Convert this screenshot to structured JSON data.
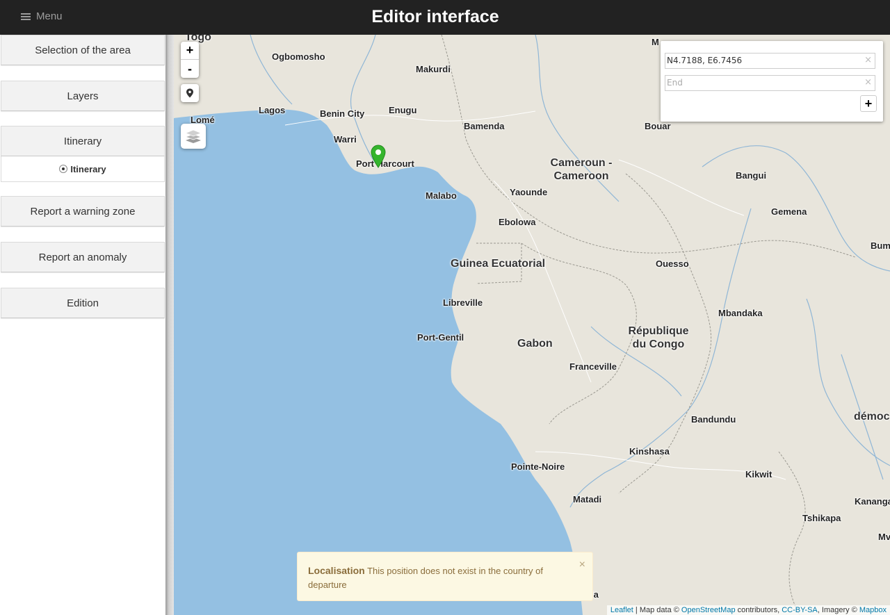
{
  "header": {
    "menu_label": "Menu",
    "title": "Editor interface"
  },
  "sidebar": {
    "selection_label": "Selection of the area",
    "layers_label": "Layers",
    "itinerary_label": "Itinerary",
    "itinerary_option": "Itinerary",
    "warning_label": "Report a warning zone",
    "anomaly_label": "Report an anomaly",
    "edition_label": "Edition"
  },
  "map": {
    "zoom_in": "+",
    "zoom_out": "-",
    "colors": {
      "sea": "#94c0e2",
      "land": "#e8e5dc",
      "river": "#8fb6d6",
      "border": "#9a9890",
      "marker": "#35b52d"
    },
    "places": [
      {
        "id": "togo",
        "name": "Togo",
        "kind": "country"
      },
      {
        "id": "ogbomosho",
        "name": "Ogbomosho",
        "kind": "city"
      },
      {
        "id": "makurdi",
        "name": "Makurdi",
        "kind": "city"
      },
      {
        "id": "lagos",
        "name": "Lagos",
        "kind": "city"
      },
      {
        "id": "benin-city",
        "name": "Benin City",
        "kind": "city"
      },
      {
        "id": "enugu",
        "name": "Enugu",
        "kind": "city"
      },
      {
        "id": "lome",
        "name": "Lomé",
        "kind": "city"
      },
      {
        "id": "warri",
        "name": "Warri",
        "kind": "city"
      },
      {
        "id": "port-harcourt",
        "name": "Port Harcourt",
        "kind": "city"
      },
      {
        "id": "bamenda",
        "name": "Bamenda",
        "kind": "city"
      },
      {
        "id": "bouar",
        "name": "Bouar",
        "kind": "city"
      },
      {
        "id": "cameroun",
        "name": "Cameroun -\nCameroon",
        "kind": "country"
      },
      {
        "id": "bangui",
        "name": "Bangui",
        "kind": "city"
      },
      {
        "id": "malabo",
        "name": "Malabo",
        "kind": "city"
      },
      {
        "id": "yaounde",
        "name": "Yaounde",
        "kind": "city"
      },
      {
        "id": "gemena",
        "name": "Gemena",
        "kind": "city"
      },
      {
        "id": "ebolowa",
        "name": "Ebolowa",
        "kind": "city"
      },
      {
        "id": "bumba",
        "name": "Bumba",
        "kind": "city"
      },
      {
        "id": "guinea-ecuatorial",
        "name": "Guinea Ecuatorial",
        "kind": "country"
      },
      {
        "id": "ouesso",
        "name": "Ouesso",
        "kind": "city"
      },
      {
        "id": "libreville",
        "name": "Libreville",
        "kind": "city"
      },
      {
        "id": "mbandaka",
        "name": "Mbandaka",
        "kind": "city"
      },
      {
        "id": "republique-du-congo",
        "name": "République\ndu Congo",
        "kind": "country"
      },
      {
        "id": "port-gentil",
        "name": "Port-Gentil",
        "kind": "city"
      },
      {
        "id": "gabon",
        "name": "Gabon",
        "kind": "country"
      },
      {
        "id": "franceville",
        "name": "Franceville",
        "kind": "city"
      },
      {
        "id": "bandundu",
        "name": "Bandundu",
        "kind": "city"
      },
      {
        "id": "democ",
        "name": "démoc",
        "kind": "country"
      },
      {
        "id": "kinshasa",
        "name": "Kinshasa",
        "kind": "city"
      },
      {
        "id": "pointe-noire",
        "name": "Pointe-Noire",
        "kind": "city"
      },
      {
        "id": "kikwit",
        "name": "Kikwit",
        "kind": "city"
      },
      {
        "id": "matadi",
        "name": "Matadi",
        "kind": "city"
      },
      {
        "id": "kananga",
        "name": "Kananga",
        "kind": "city"
      },
      {
        "id": "tshikapa",
        "name": "Tshikapa",
        "kind": "city"
      },
      {
        "id": "mv",
        "name": "Mv",
        "kind": "city"
      },
      {
        "id": "la",
        "name": "la",
        "kind": "city"
      },
      {
        "id": "m-top",
        "name": "M",
        "kind": "city"
      }
    ]
  },
  "routing": {
    "start_value": "N4.7188, E6.7456",
    "end_placeholder": "End",
    "clear_symbol": "×",
    "add_symbol": "+"
  },
  "alert": {
    "title": "Localisation",
    "message": "This position does not exist in the country of departure",
    "close_symbol": "×"
  },
  "attribution": {
    "leaflet": "Leaflet",
    "map_data": " | Map data © ",
    "osm": "OpenStreetMap",
    "contributors": " contributors, ",
    "license": "CC-BY-SA",
    "imagery": ", Imagery © ",
    "mapbox": "Mapbox"
  }
}
